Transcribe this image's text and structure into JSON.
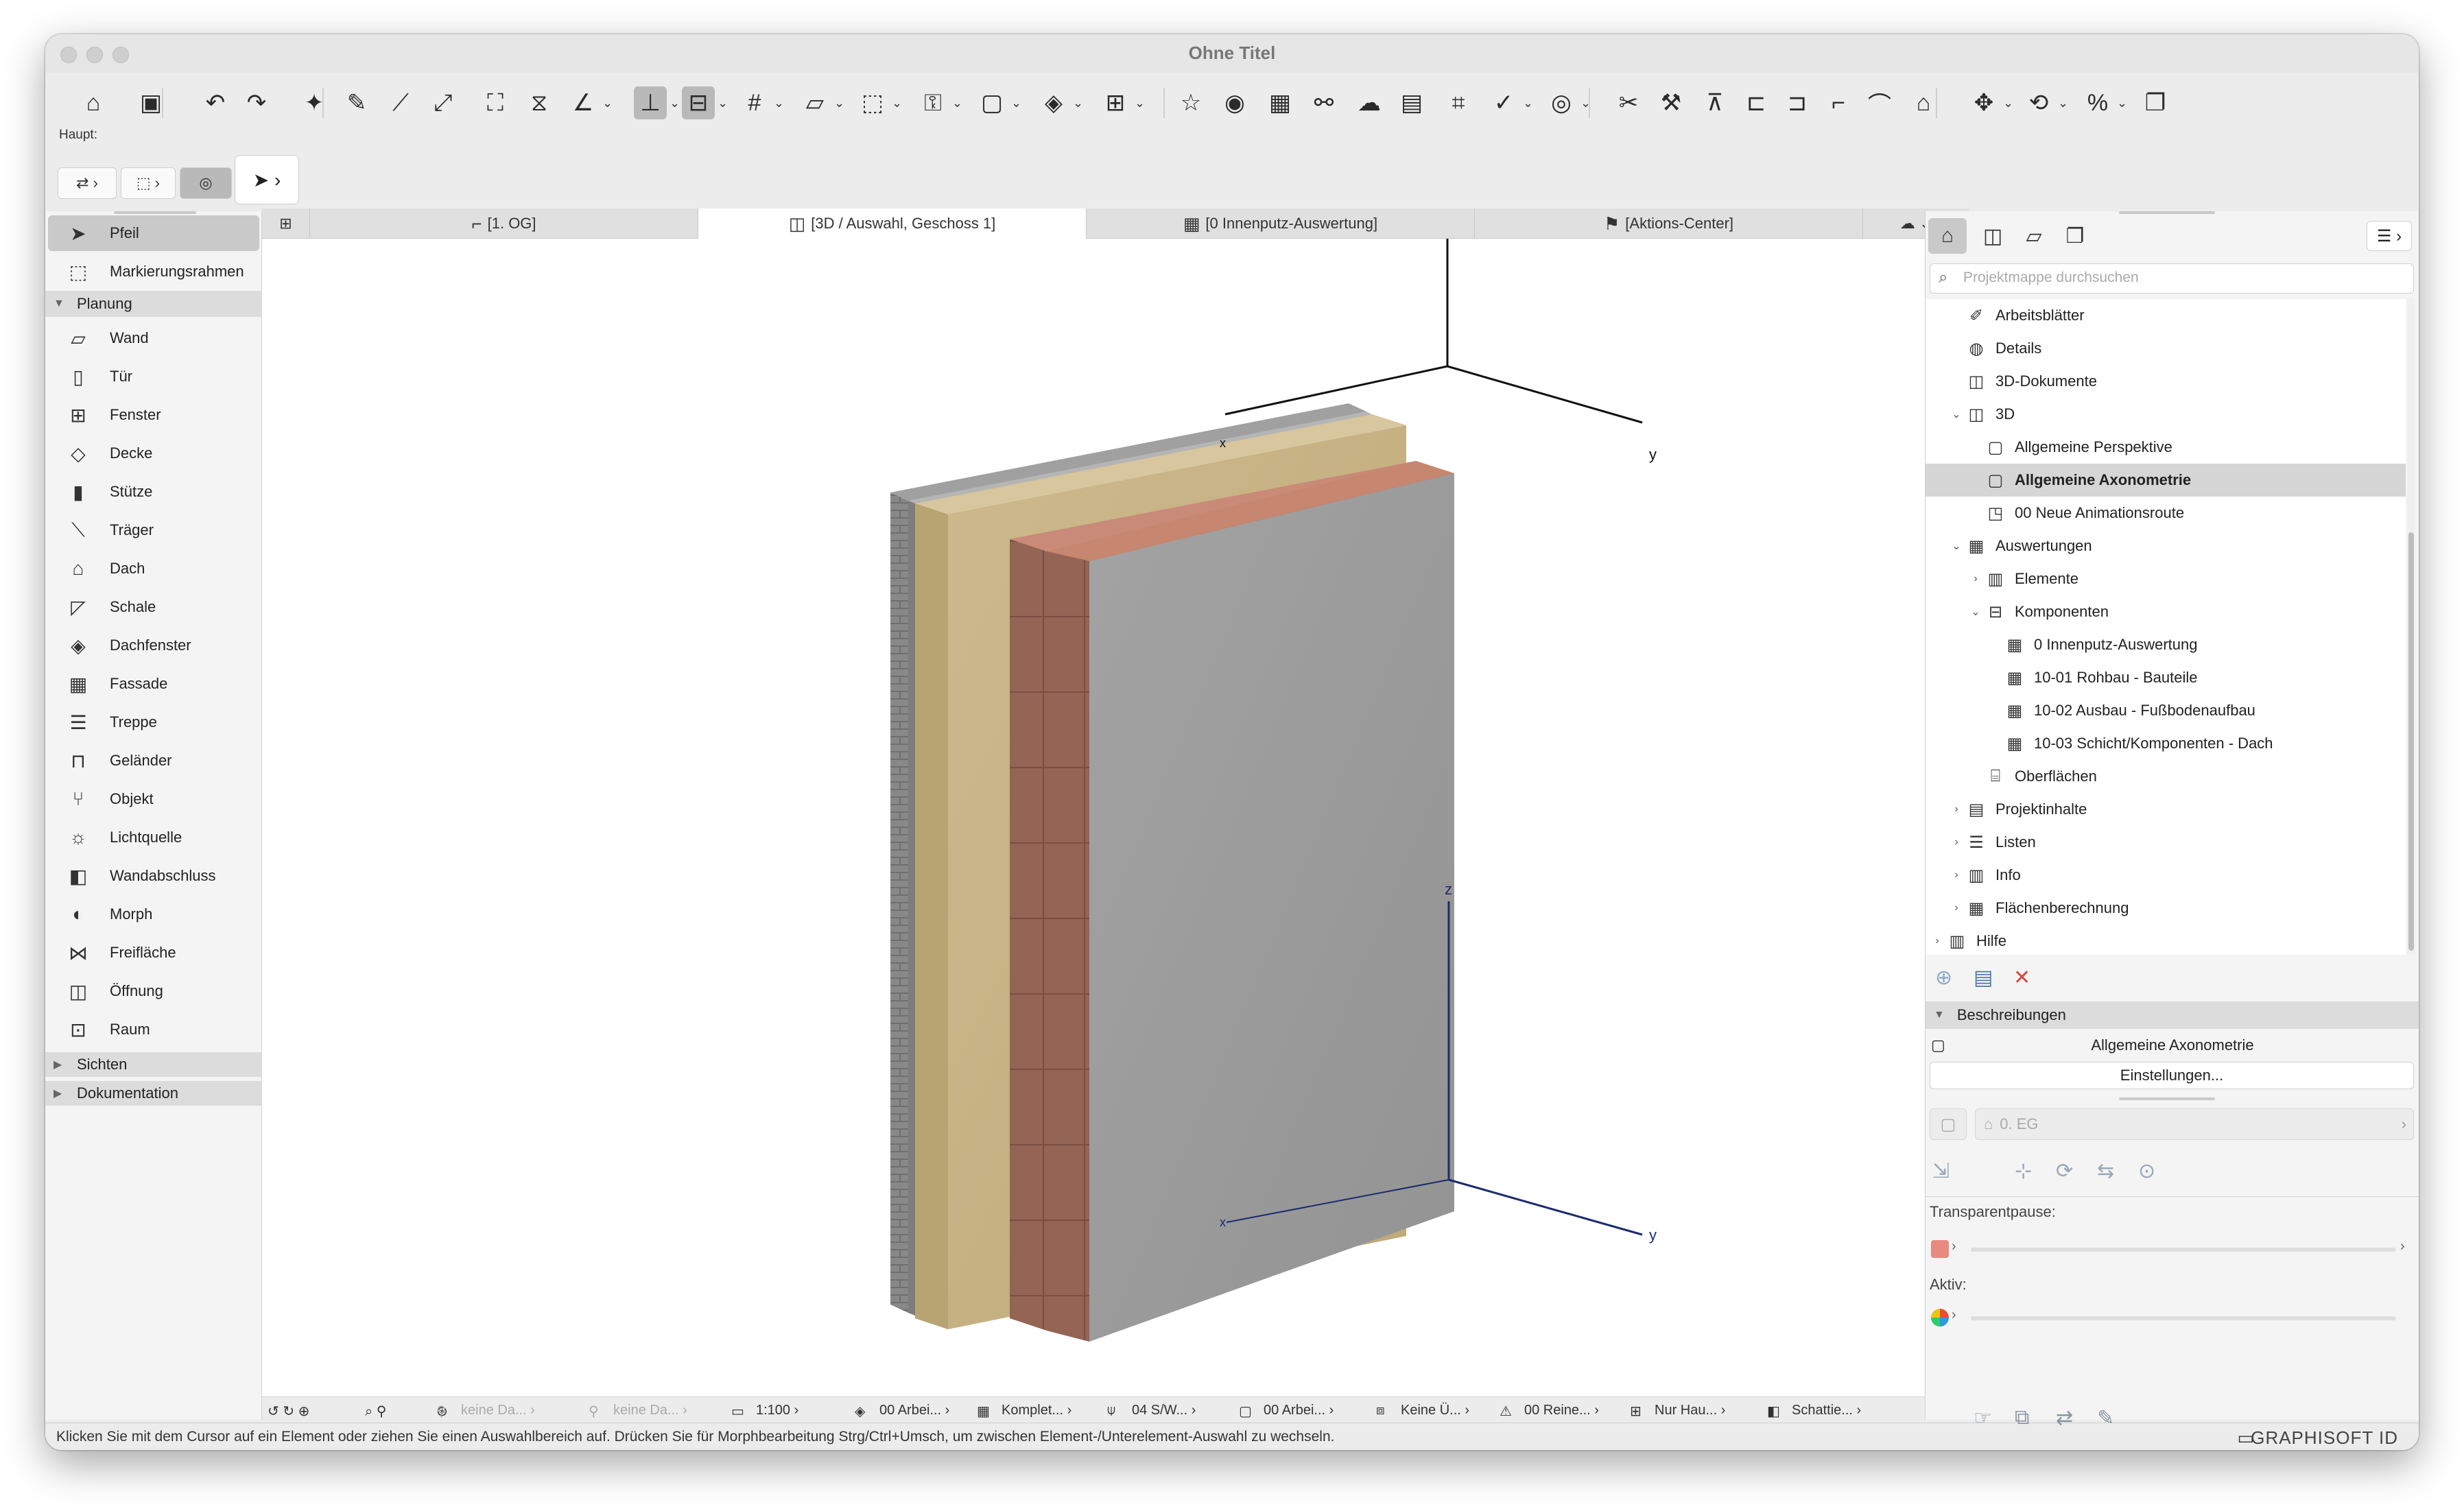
{
  "window": {
    "title": "Ohne Titel"
  },
  "toolbar": {
    "haupt_label": "Haupt:",
    "icons": [
      "home-icon",
      "save-icon",
      "undo-icon",
      "redo-icon",
      "magic-wand-icon",
      "eyedropper-icon",
      "syringe-icon",
      "scale-icon",
      "fit-icon",
      "measure-icon",
      "angle-icon",
      "snap-icon",
      "guide-icon",
      "grid-icon",
      "plane-icon",
      "select-icon",
      "lock-icon",
      "layer-icon",
      "view-icon",
      "group-icon",
      "star-icon",
      "render-icon",
      "mark-icon",
      "link-icon",
      "cloud-icon",
      "report-icon",
      "tag-icon",
      "check-icon",
      "circle-icon",
      "scissors-icon",
      "hammer-icon",
      "trim-icon",
      "merge-icon",
      "split-icon",
      "corner-icon",
      "curve-icon",
      "roof-icon",
      "move-icon",
      "rotate-icon",
      "percent-icon",
      "copy-icon"
    ]
  },
  "palette": {
    "items": [
      {
        "label": "Pfeil",
        "icon": "arrow-icon",
        "selected": true
      },
      {
        "label": "Markierungsrahmen",
        "icon": "marquee-icon",
        "selected": false
      }
    ],
    "planung": {
      "label": "Planung",
      "items": [
        {
          "label": "Wand",
          "icon": "wall-icon"
        },
        {
          "label": "Tür",
          "icon": "door-icon"
        },
        {
          "label": "Fenster",
          "icon": "window-icon"
        },
        {
          "label": "Decke",
          "icon": "slab-icon"
        },
        {
          "label": "Stütze",
          "icon": "column-icon"
        },
        {
          "label": "Träger",
          "icon": "beam-icon"
        },
        {
          "label": "Dach",
          "icon": "roof-icon"
        },
        {
          "label": "Schale",
          "icon": "shell-icon"
        },
        {
          "label": "Dachfenster",
          "icon": "skylight-icon"
        },
        {
          "label": "Fassade",
          "icon": "curtain-wall-icon"
        },
        {
          "label": "Treppe",
          "icon": "stair-icon"
        },
        {
          "label": "Geländer",
          "icon": "railing-icon"
        },
        {
          "label": "Objekt",
          "icon": "object-icon"
        },
        {
          "label": "Lichtquelle",
          "icon": "lamp-icon"
        },
        {
          "label": "Wandabschluss",
          "icon": "wall-end-icon"
        },
        {
          "label": "Morph",
          "icon": "morph-icon"
        },
        {
          "label": "Freifläche",
          "icon": "mesh-icon"
        },
        {
          "label": "Öffnung",
          "icon": "opening-icon"
        },
        {
          "label": "Raum",
          "icon": "zone-icon"
        }
      ]
    },
    "sichten": "Sichten",
    "dokumentation": "Dokumentation"
  },
  "tabs": [
    {
      "label": "[1. OG]",
      "icon": "floorplan-icon",
      "active": false
    },
    {
      "label": "[3D / Auswahl, Geschoss 1]",
      "icon": "cube-icon",
      "active": true
    },
    {
      "label": "[0 Innenputz-Auswertung]",
      "icon": "table-icon",
      "active": false
    },
    {
      "label": "[Aktions-Center]",
      "icon": "action-center-icon",
      "active": false
    }
  ],
  "viewport": {
    "axis_labels": {
      "y_top": "y",
      "z": "z",
      "y_bottom": "y",
      "x_top": "x",
      "x_bottom": "x"
    }
  },
  "bottombar": {
    "items": [
      {
        "label": "keine Da...",
        "dim": true
      },
      {
        "label": "keine Da...",
        "dim": true
      },
      {
        "label": "1:100",
        "dim": false
      },
      {
        "label": "00 Arbei...",
        "dim": false
      },
      {
        "label": "Komplet...",
        "dim": false
      },
      {
        "label": "04 S/W...",
        "dim": false
      },
      {
        "label": "00 Arbei...",
        "dim": false
      },
      {
        "label": "Keine Ü...",
        "dim": false
      },
      {
        "label": "00 Reine...",
        "dim": false
      },
      {
        "label": "Nur Hau...",
        "dim": false
      },
      {
        "label": "Schattie...",
        "dim": false
      }
    ]
  },
  "status": {
    "text": "Klicken Sie mit dem Cursor auf ein Element oder ziehen Sie einen Auswahlbereich auf. Drücken Sie für Morphbearbeitung Strg/Ctrl+Umsch, um zwischen Element-/Unterelement-Auswahl zu wechseln.",
    "brand": "GRAPHISOFT ID"
  },
  "navigator": {
    "search_placeholder": "Projektmappe durchsuchen",
    "tree": [
      {
        "label": "Arbeitsblätter",
        "level": 1,
        "arrow": "",
        "icon": "worksheet-icon"
      },
      {
        "label": "Details",
        "level": 1,
        "arrow": "",
        "icon": "detail-icon"
      },
      {
        "label": "3D-Dokumente",
        "level": 1,
        "arrow": "",
        "icon": "3d-doc-icon"
      },
      {
        "label": "3D",
        "level": 1,
        "arrow": "open",
        "icon": "cube-icon"
      },
      {
        "label": "Allgemeine Perspektive",
        "level": 2,
        "arrow": "",
        "icon": "perspective-icon"
      },
      {
        "label": "Allgemeine Axonometrie",
        "level": 2,
        "arrow": "",
        "icon": "axonometry-icon",
        "selected": true
      },
      {
        "label": "00 Neue Animationsroute",
        "level": 2,
        "arrow": "",
        "icon": "camera-icon"
      },
      {
        "label": "Auswertungen",
        "level": 1,
        "arrow": "open",
        "icon": "table-icon"
      },
      {
        "label": "Elemente",
        "level": 2,
        "arrow": "closed",
        "icon": "elements-icon"
      },
      {
        "label": "Komponenten",
        "level": 2,
        "arrow": "open",
        "icon": "components-icon"
      },
      {
        "label": "0 Innenputz-Auswertung",
        "level": 3,
        "arrow": "",
        "icon": "table-icon"
      },
      {
        "label": "10-01 Rohbau - Bauteile",
        "level": 3,
        "arrow": "",
        "icon": "table-icon"
      },
      {
        "label": "10-02 Ausbau - Fußbodenaufbau",
        "level": 3,
        "arrow": "",
        "icon": "table-icon"
      },
      {
        "label": "10-03 Schicht/Komponenten - Dach",
        "level": 3,
        "arrow": "",
        "icon": "table-icon"
      },
      {
        "label": "Oberflächen",
        "level": 2,
        "arrow": "",
        "icon": "surfaces-icon"
      },
      {
        "label": "Projektinhalte",
        "level": 1,
        "arrow": "closed",
        "icon": "index-icon"
      },
      {
        "label": "Listen",
        "level": 1,
        "arrow": "closed",
        "icon": "list-icon"
      },
      {
        "label": "Info",
        "level": 1,
        "arrow": "closed",
        "icon": "info-icon"
      },
      {
        "label": "Flächenberechnung",
        "level": 1,
        "arrow": "closed",
        "icon": "area-calc-icon"
      },
      {
        "label": "Hilfe",
        "level": 0,
        "arrow": "closed",
        "icon": "help-icon"
      }
    ],
    "beschreibungen": "Beschreibungen",
    "view_name": "Allgemeine Axonometrie",
    "einstellungen": "Einstellungen...",
    "layer_field": "0. EG",
    "transparentpause": "Transparentpause:",
    "aktiv": "Aktiv:"
  },
  "colors": {
    "wall_brick": "#7a7a7a",
    "insulation": "#c8b58a",
    "masonry": "#9a6a58",
    "plaster": "#9c9c9c",
    "axis_black": "#111111",
    "axis_blue": "#1a2b6e"
  }
}
